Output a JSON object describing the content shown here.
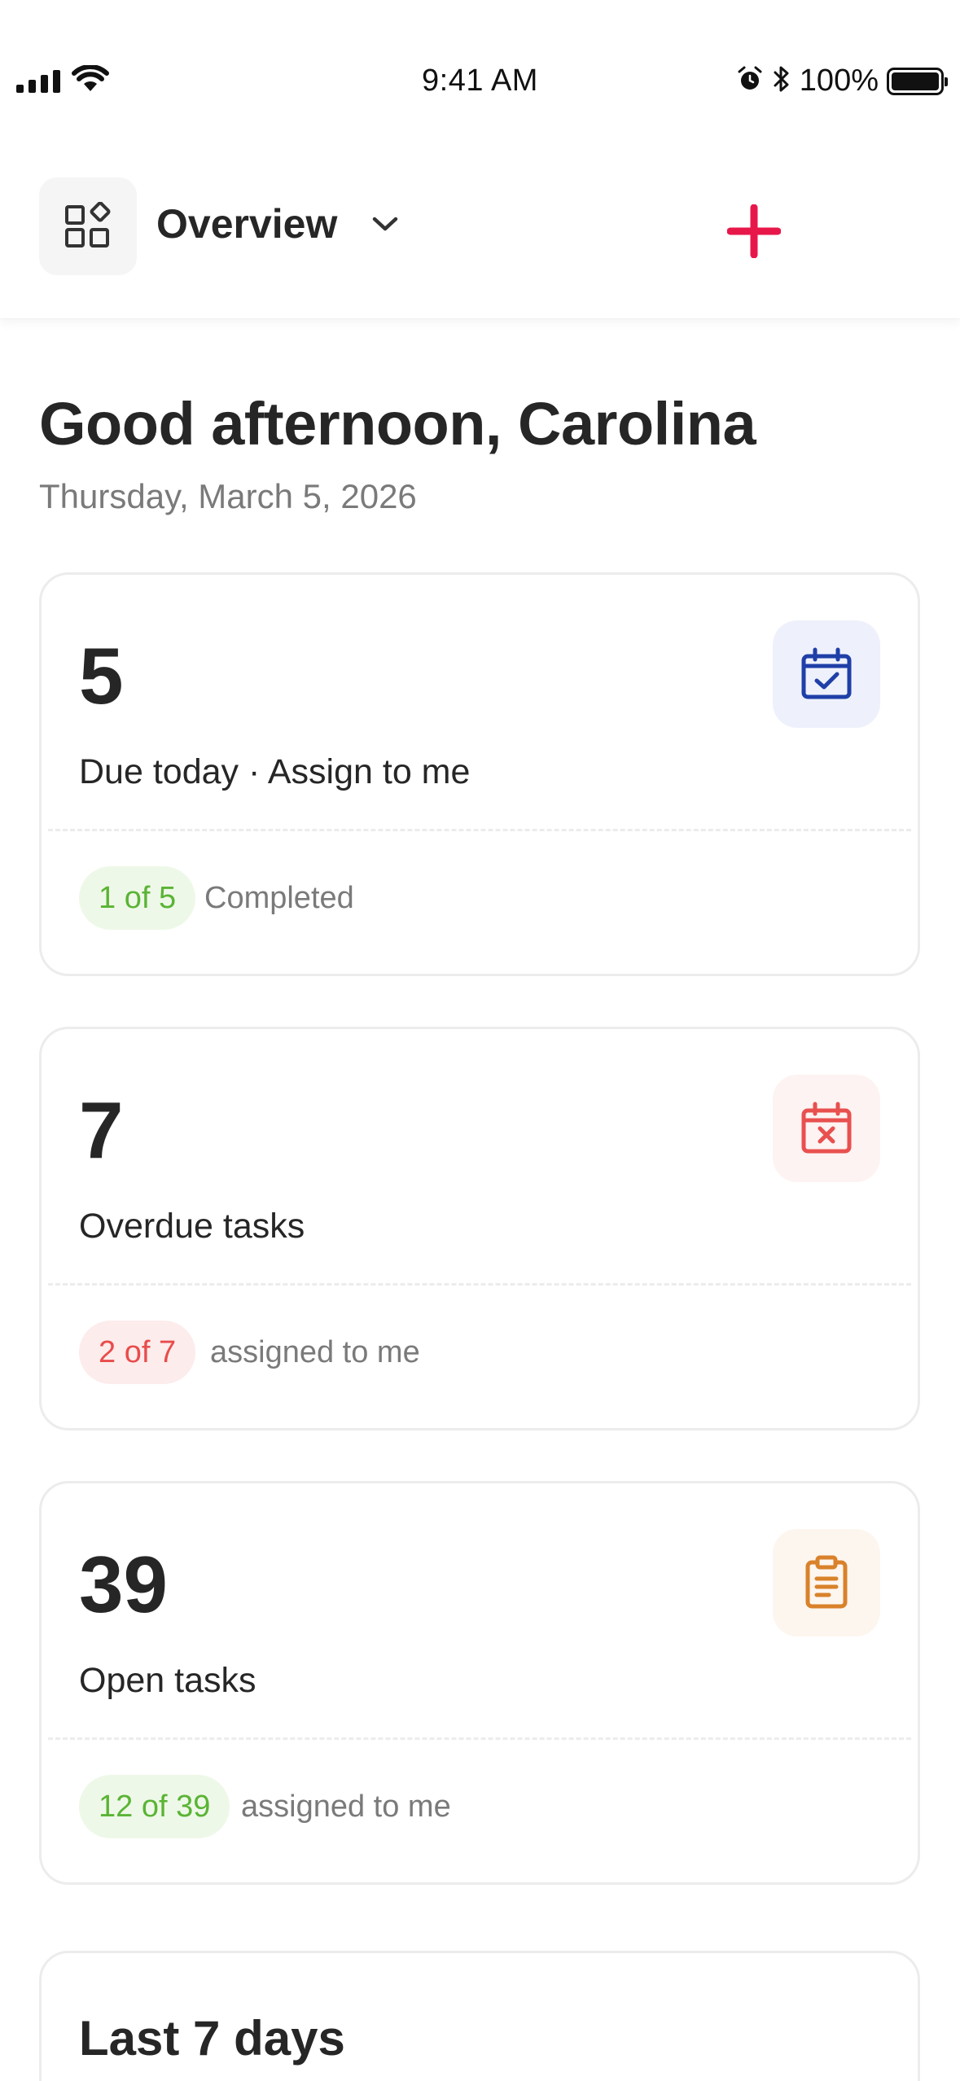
{
  "status_bar": {
    "time": "9:41 AM",
    "battery_percent": "100%",
    "battery_level": 1.0
  },
  "header": {
    "title": "Overview",
    "menu_icon": "apps-grid-icon",
    "add_icon": "plus-icon",
    "accent_color": "#e8174a"
  },
  "greeting": {
    "headline": "Good afternoon, Carolina",
    "date": "Thursday, March 5, 2026"
  },
  "cards": [
    {
      "count": "5",
      "label": "Due today · Assign to me",
      "icon": "calendar-check-icon",
      "icon_color": "#1f3fa8",
      "pill": "1 of 5",
      "pill_style": "green",
      "caption": "Completed"
    },
    {
      "count": "7",
      "label": "Overdue tasks",
      "icon": "calendar-x-icon",
      "icon_color": "#e8504f",
      "pill": "2 of 7",
      "pill_style": "red",
      "caption": "assigned to me"
    },
    {
      "count": "39",
      "label": "Open tasks",
      "icon": "clipboard-icon",
      "icon_color": "#d9822b",
      "pill": "12 of 39",
      "pill_style": "green",
      "caption": "assigned to me"
    }
  ],
  "summary": {
    "title": "Last 7 days"
  }
}
